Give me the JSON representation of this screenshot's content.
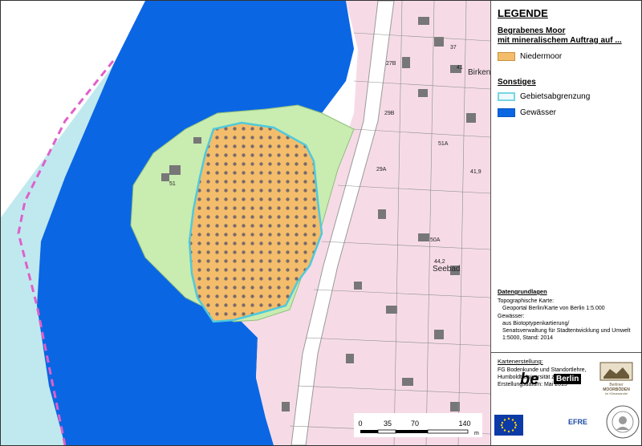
{
  "legend": {
    "title": "LEGENDE",
    "section_moor": "Begrabenes Moor\nmit mineralischem Auftrag auf ...",
    "item_niedermoor": "Niedermoor",
    "section_sonstiges": "Sonstiges",
    "item_gebietsabgrenzung": "Gebietsabgrenzung",
    "item_gewaesser": "Gewässer",
    "colors": {
      "moor_fill": "#f3bd6c",
      "moor_dot": "#7a6a6a",
      "boundary": "#76d5e3",
      "water": "#0b66e4",
      "green": "#c9ecb1",
      "building_area": "#f6dbe6"
    }
  },
  "datengrundlagen": {
    "title": "Datengrundlagen",
    "topo_label": "Topographische Karte:",
    "topo_source": "Geoportal Berlin/Karte von Berlin 1:5.000",
    "gew_label": "Gewässer:",
    "gew_l1": "aus Biotoptypenkartierung/",
    "gew_l2": "Senatsverwaltung für Stadtentwicklung und Umwelt",
    "gew_l3": "1:5000, Stand: 2014"
  },
  "kartenerstellung": {
    "title": "Kartenerstellung:",
    "l1": "FG Bodenkunde und Standortlehre,",
    "l2": "Humboldt-Universität zu Berlin",
    "l3": "Erstellungsdatum: Mai 2015"
  },
  "logos": {
    "be": "be",
    "berlin": "Berlin",
    "moor_l1": "Berliner",
    "moor_l2": "MOORBÖDEN",
    "moor_l3": "im Klimawandel",
    "efre": "EFRE"
  },
  "scale": {
    "labels": [
      "0",
      "35",
      "70",
      "140"
    ],
    "unit": "m"
  },
  "map_labels": {
    "birken": "Birken",
    "seebad": "Seebad",
    "n_419": "41,9",
    "n_44": "44,2",
    "n_51": "51",
    "n_51a": "51A",
    "n_29a": "29A",
    "n_50a": "50A",
    "n_27b": "27B",
    "n_29b": "29B",
    "n_37": "37",
    "n_41": "41"
  }
}
